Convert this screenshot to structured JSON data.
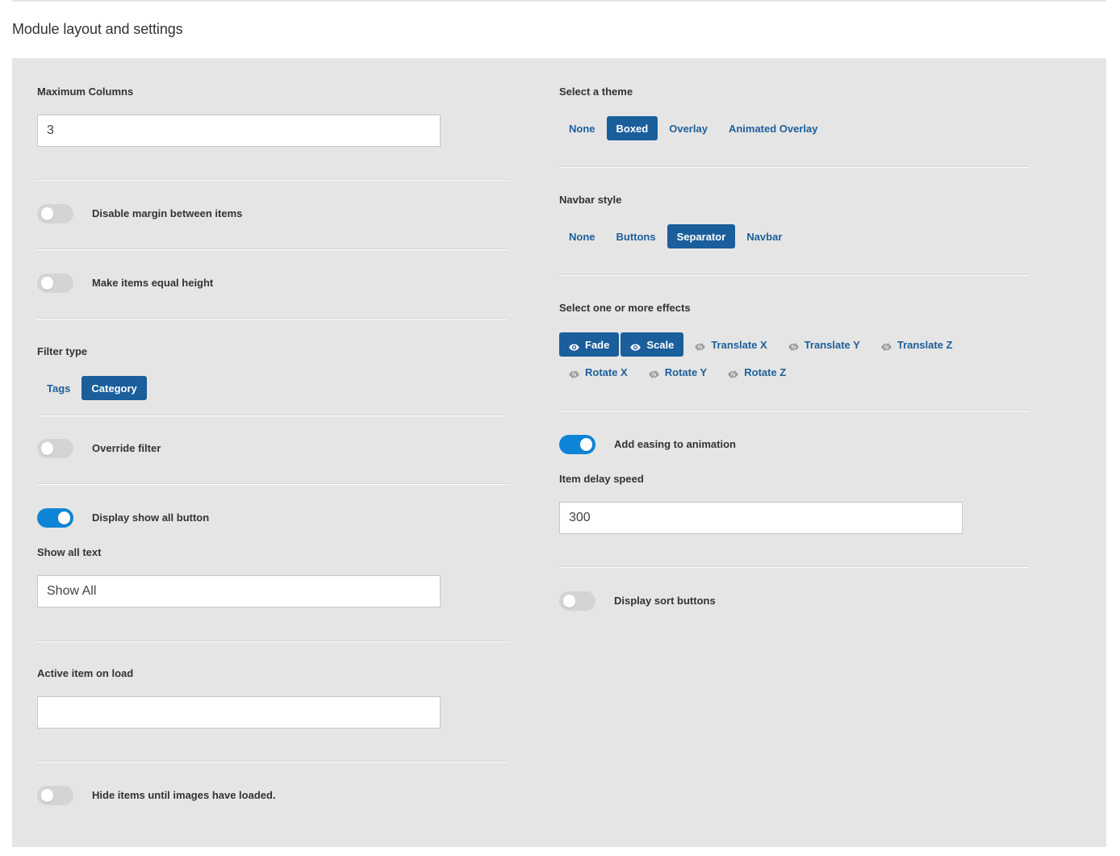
{
  "page": {
    "title": "Module layout and settings"
  },
  "colors": {
    "accent": "#1a5e9c",
    "toggle_on": "#0e84d6",
    "toggle_off": "#d4d4d4",
    "panel_bg": "#e5e5e5"
  },
  "left": {
    "max_columns": {
      "label": "Maximum Columns",
      "value": "3"
    },
    "disable_margin": {
      "label": "Disable margin between items",
      "on": false
    },
    "equal_height": {
      "label": "Make items equal height",
      "on": false
    },
    "filter_type": {
      "label": "Filter type",
      "options": [
        "Tags",
        "Category"
      ],
      "selected": "Category"
    },
    "override_filter": {
      "label": "Override filter",
      "on": false
    },
    "show_all_button": {
      "label": "Display show all button",
      "on": true
    },
    "show_all_text": {
      "label": "Show all text",
      "value": "Show All"
    },
    "active_item": {
      "label": "Active item on load",
      "value": ""
    },
    "hide_until_loaded": {
      "label": "Hide items until images have loaded.",
      "on": false
    }
  },
  "right": {
    "theme": {
      "label": "Select a theme",
      "options": [
        "None",
        "Boxed",
        "Overlay",
        "Animated Overlay"
      ],
      "selected": "Boxed"
    },
    "navbar_style": {
      "label": "Navbar style",
      "options": [
        "None",
        "Buttons",
        "Separator",
        "Navbar"
      ],
      "selected": "Separator"
    },
    "effects": {
      "label": "Select one or more effects",
      "items": [
        {
          "label": "Fade",
          "active": true,
          "icon": "eye-icon"
        },
        {
          "label": "Scale",
          "active": true,
          "icon": "eye-icon"
        },
        {
          "label": "Translate X",
          "active": false,
          "icon": "eye-slash-icon"
        },
        {
          "label": "Translate Y",
          "active": false,
          "icon": "eye-slash-icon"
        },
        {
          "label": "Translate Z",
          "active": false,
          "icon": "eye-slash-icon"
        },
        {
          "label": "Rotate X",
          "active": false,
          "icon": "eye-slash-icon"
        },
        {
          "label": "Rotate Y",
          "active": false,
          "icon": "eye-slash-icon"
        },
        {
          "label": "Rotate Z",
          "active": false,
          "icon": "eye-slash-icon"
        }
      ]
    },
    "easing": {
      "label": "Add easing to animation",
      "on": true
    },
    "item_delay": {
      "label": "Item delay speed",
      "value": "300"
    },
    "sort_buttons": {
      "label": "Display sort buttons",
      "on": false
    }
  }
}
